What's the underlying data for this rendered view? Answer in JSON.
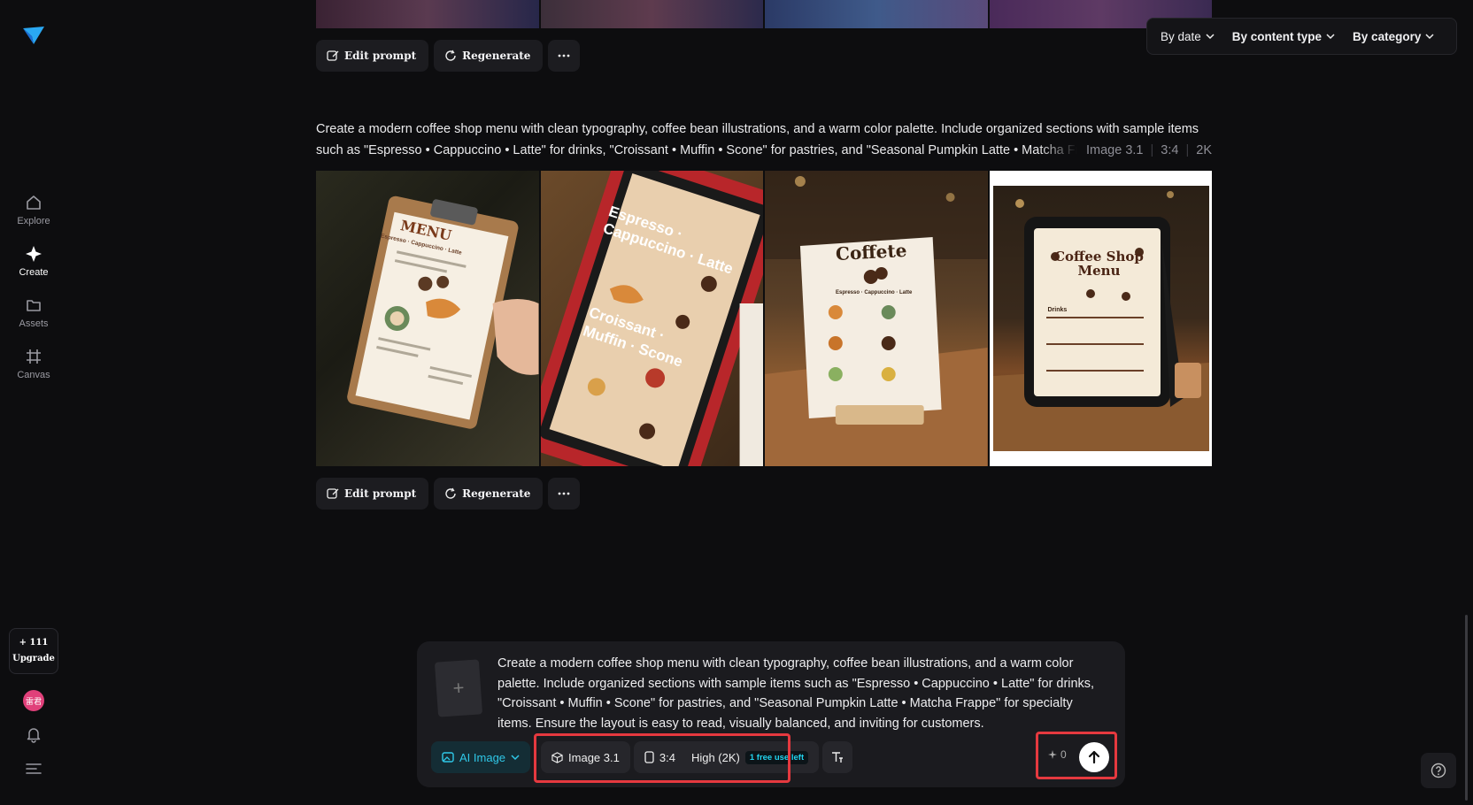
{
  "sidebar": {
    "items": [
      {
        "label": "Explore",
        "icon": "home-icon"
      },
      {
        "label": "Create",
        "icon": "sparkle-icon"
      },
      {
        "label": "Assets",
        "icon": "folder-icon"
      },
      {
        "label": "Canvas",
        "icon": "canvas-icon"
      }
    ],
    "upgrade": {
      "credits": "+ 111",
      "label": "Upgrade"
    },
    "avatar_text": "雷君"
  },
  "filters": {
    "by_date": "By date",
    "by_content_type": "By content type",
    "by_category": "By category"
  },
  "actions": {
    "edit_prompt": "Edit prompt",
    "regenerate": "Regenerate"
  },
  "generation": {
    "prompt_line1": "Create a modern coffee shop menu with clean typography, coffee bean illustrations, and a warm color palette. Include organized sections with sample items",
    "prompt_line2": "such as \"Espresso • Cappuccino • Latte\" for drinks, \"Croissant • Muffin • Scone\" for pastries, and \"Seasonal Pumpkin Latte • Matcha Frappe\" for specialty items.",
    "model": "Image 3.1",
    "ratio": "3:4",
    "resolution": "2K",
    "images": [
      {
        "title": "MENU",
        "line1": "Espresso · Cappuccino · Latte"
      },
      {
        "title": "Espresso · Cappuccino · Latte",
        "line1": "Croissant · Muffin · Scone"
      },
      {
        "title": "Coffete",
        "line1": "Espresso · Cappuccino · Latte"
      },
      {
        "title": "Coffee Shop Menu",
        "line1": "Drinks"
      }
    ]
  },
  "composer": {
    "prompt": "Create a modern coffee shop menu with clean typography, coffee bean illustrations, and a warm color palette. Include organized sections with sample items such as \"Espresso • Cappuccino • Latte\" for drinks, \"Croissant • Muffin • Scone\" for pastries, and \"Seasonal Pumpkin Latte • Matcha Frappe\" for specialty items. Ensure the layout is easy to read, visually balanced, and inviting for customers.",
    "mode": "AI Image",
    "model": "Image 3.1",
    "ratio": "3:4",
    "quality": "High (2K)",
    "free_badge": "1 free use left",
    "credits": "0"
  },
  "colors": {
    "accent": "#22d3ee",
    "highlight": "#e5393f",
    "background": "#0d0d0f"
  }
}
